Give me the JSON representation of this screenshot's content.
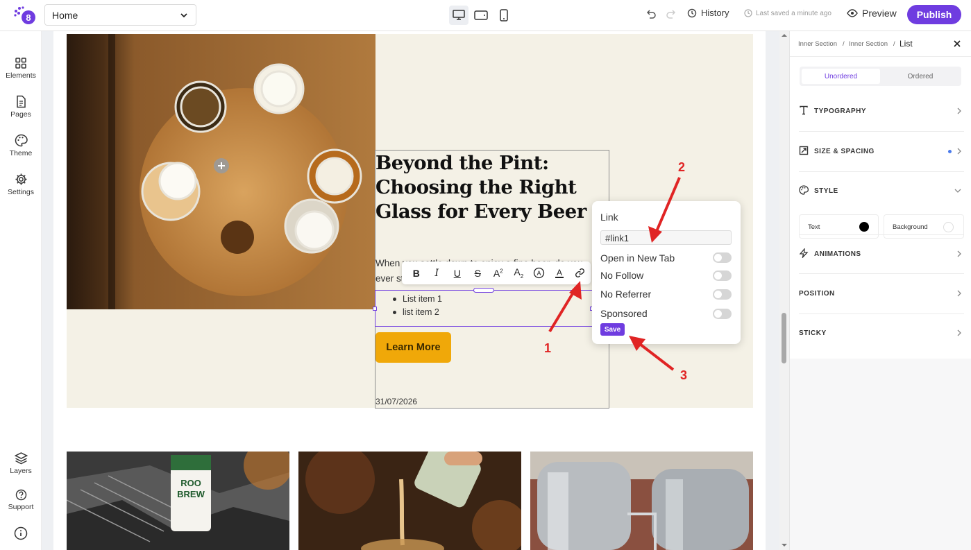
{
  "topbar": {
    "page_select": "Home",
    "history_label": "History",
    "saved_label": "Last saved a minute ago",
    "preview_label": "Preview",
    "publish_label": "Publish"
  },
  "leftbar": {
    "items": [
      {
        "label": "Elements",
        "icon": "grid-icon"
      },
      {
        "label": "Pages",
        "icon": "document-icon"
      },
      {
        "label": "Theme",
        "icon": "palette-icon"
      },
      {
        "label": "Settings",
        "icon": "gear-icon"
      }
    ],
    "bottom": [
      {
        "label": "Layers",
        "icon": "layers-icon"
      },
      {
        "label": "Support",
        "icon": "help-icon"
      },
      {
        "label": "",
        "icon": "info-icon"
      }
    ]
  },
  "hero": {
    "headline": "Beyond the Pint: Choosing the Right Glass for Every Beer",
    "paragraph": "When you settle down to enjoy a fine beer, do you ever stop to think about the glass it comes in?",
    "list": [
      "List item 1",
      "list item 2"
    ],
    "button": "Learn More",
    "date": "31/07/2026"
  },
  "link_popover": {
    "title": "Link",
    "value": "#link1",
    "options": [
      "Open in New Tab",
      "No Follow",
      "No Referrer",
      "Sponsored"
    ],
    "save": "Save"
  },
  "annotations": [
    "1",
    "2",
    "3"
  ],
  "right_panel": {
    "breadcrumb": [
      "Inner Section",
      "Inner Section",
      "List"
    ],
    "segments": [
      "Unordered",
      "Ordered"
    ],
    "sections": [
      "TYPOGRAPHY",
      "SIZE & SPACING",
      "STYLE",
      "ANIMATIONS",
      "POSITION",
      "STICKY"
    ],
    "style_text": "Text",
    "style_background": "Background"
  },
  "colors": {
    "accent": "#6f3ce0",
    "button": "#f0a809",
    "hero_bg": "#f4f1e6",
    "arrow": "#e02424"
  }
}
